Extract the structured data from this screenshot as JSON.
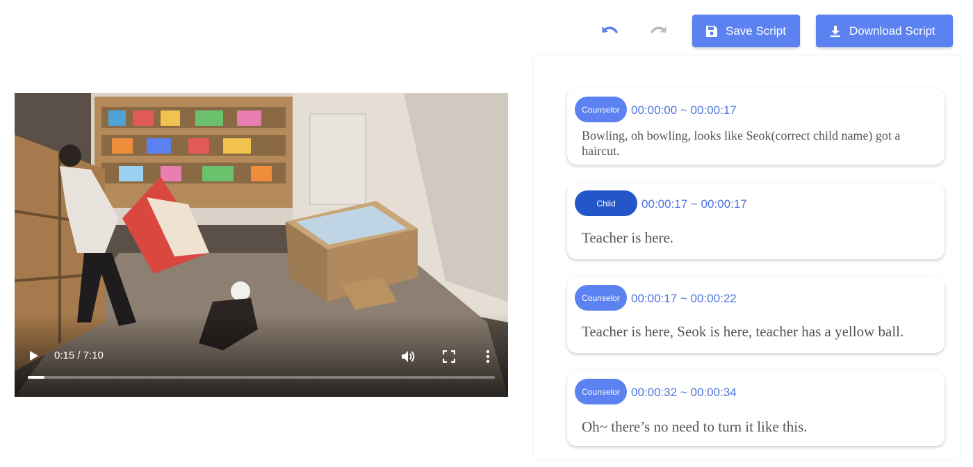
{
  "toolbar": {
    "undo_icon": "undo-icon",
    "redo_icon": "redo-icon",
    "save_label": "Save Script",
    "save_icon": "floppy-disk-icon",
    "download_label": "Download Script",
    "download_icon": "download-icon",
    "accent_color": "#5b82f0"
  },
  "video": {
    "time_display": "0:15 / 7:10",
    "progress_fraction": 0.035,
    "play_icon": "play-icon",
    "volume_icon": "volume-icon",
    "fullscreen_icon": "fullscreen-icon",
    "more_icon": "more-vertical-icon"
  },
  "transcript": [
    {
      "speaker": "Counselor",
      "time": "00:00:00 ~ 00:00:17",
      "text": "Bowling, oh bowling, looks like Seok(correct child name) got a haircut."
    },
    {
      "speaker": "Child",
      "time": "00:00:17 ~ 00:00:17",
      "text": "Teacher is here."
    },
    {
      "speaker": "Counselor",
      "time": "00:00:17 ~ 00:00:22",
      "text": "Teacher is here, Seok is here, teacher has a yellow ball."
    },
    {
      "speaker": "Counselor",
      "time": "00:00:32 ~ 00:00:34",
      "text": "Oh~ there’s no need to turn it like this."
    }
  ],
  "colors": {
    "counselor_badge": "#5b82f0",
    "child_badge": "#2356c9",
    "timestamp": "#4d73de"
  }
}
